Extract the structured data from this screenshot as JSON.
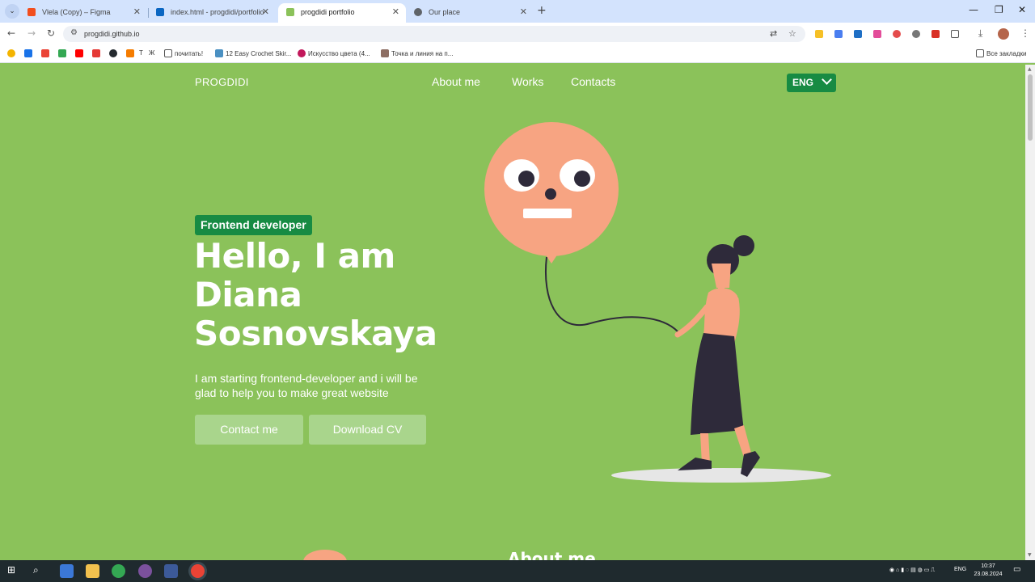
{
  "browser": {
    "tabs": [
      {
        "title": "Vlela (Copy) – Figma",
        "icon_color": "#f24e1e",
        "active": false
      },
      {
        "title": "index.html - progdidi/portfolio",
        "icon_color": "#0a66c2",
        "active": false
      },
      {
        "title": "progdidi portfolio",
        "icon_color": "#8bc25a",
        "active": true
      },
      {
        "title": "Our place",
        "icon_color": "#5f6368",
        "active": false
      }
    ],
    "url": "progdidi.github.io",
    "bookmarks": [
      {
        "label": "Т",
        "color": "#444"
      },
      {
        "label": "Ж",
        "color": "#444"
      },
      {
        "label": "почитать!",
        "color": "#5f6368"
      },
      {
        "label": "12 Easy Crochet Skir...",
        "color": "#4a90c2"
      },
      {
        "label": "Искусство цвета (4...",
        "color": "#c2185b"
      },
      {
        "label": "Точка и линия на п...",
        "color": "#8d6e63"
      }
    ],
    "all_bookmarks": "Все закладки"
  },
  "site": {
    "logo": "PROGDIDI",
    "nav": [
      "About me",
      "Works",
      "Contacts"
    ],
    "lang": "ENG",
    "badge": "Frontend developer",
    "headline": [
      "Hello, I am",
      "Diana",
      "Sosnovskaya"
    ],
    "intro": "I am starting frontend-developer and i will be glad to help you to make great website",
    "buttons": {
      "contact": "Contact me",
      "cv": "Download CV"
    },
    "next_section": "About me"
  },
  "taskbar": {
    "lang": "ENG",
    "time": "10:37",
    "date": "23.08.2024"
  },
  "colors": {
    "background": "#8bc25a",
    "accent": "#178b43",
    "button": "#a9d58c",
    "balloon": "#f7a482",
    "figure_dark": "#2e2a3a"
  }
}
